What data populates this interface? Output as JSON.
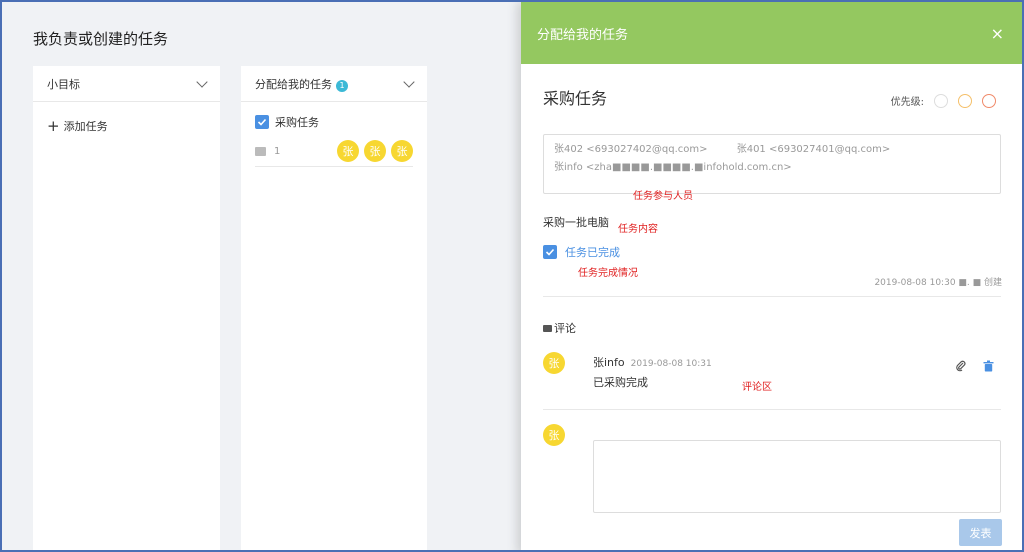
{
  "page": {
    "title": "我负责或创建的任务"
  },
  "columns": [
    {
      "title": "小目标",
      "add_task": "添加任务"
    },
    {
      "title": "分配给我的任务",
      "badge": "1"
    }
  ],
  "card": {
    "title": "采购任务",
    "comment_count": "1",
    "avatars": [
      "张",
      "张",
      "张"
    ]
  },
  "panel": {
    "header_title": "分配给我的任务",
    "close_symbol": "×",
    "task_title": "采购任务",
    "priority_label": "优先级:",
    "priority_colors": [
      "#dddddd",
      "#f5c06a",
      "#f08a6a"
    ],
    "participants": [
      "张402 <693027402@qq.com>",
      "张401 <693027401@qq.com>",
      "张info <zha■■■■.■■■■.■infohold.com.cn>"
    ],
    "annotation_participants": "任务参与人员",
    "content": "采购一批电脑",
    "annotation_content": "任务内容",
    "status_text": "任务已完成",
    "annotation_status": "任务完成情况",
    "meta": "2019-08-08 10:30 ■. ■ 创建",
    "comment_heading": "评论",
    "comment": {
      "avatar": "张",
      "author": "张info",
      "time": "2019-08-08 10:31",
      "text": "已采购完成"
    },
    "annotation_comments": "评论区",
    "new_comment_avatar": "张",
    "send_label": "发表"
  }
}
